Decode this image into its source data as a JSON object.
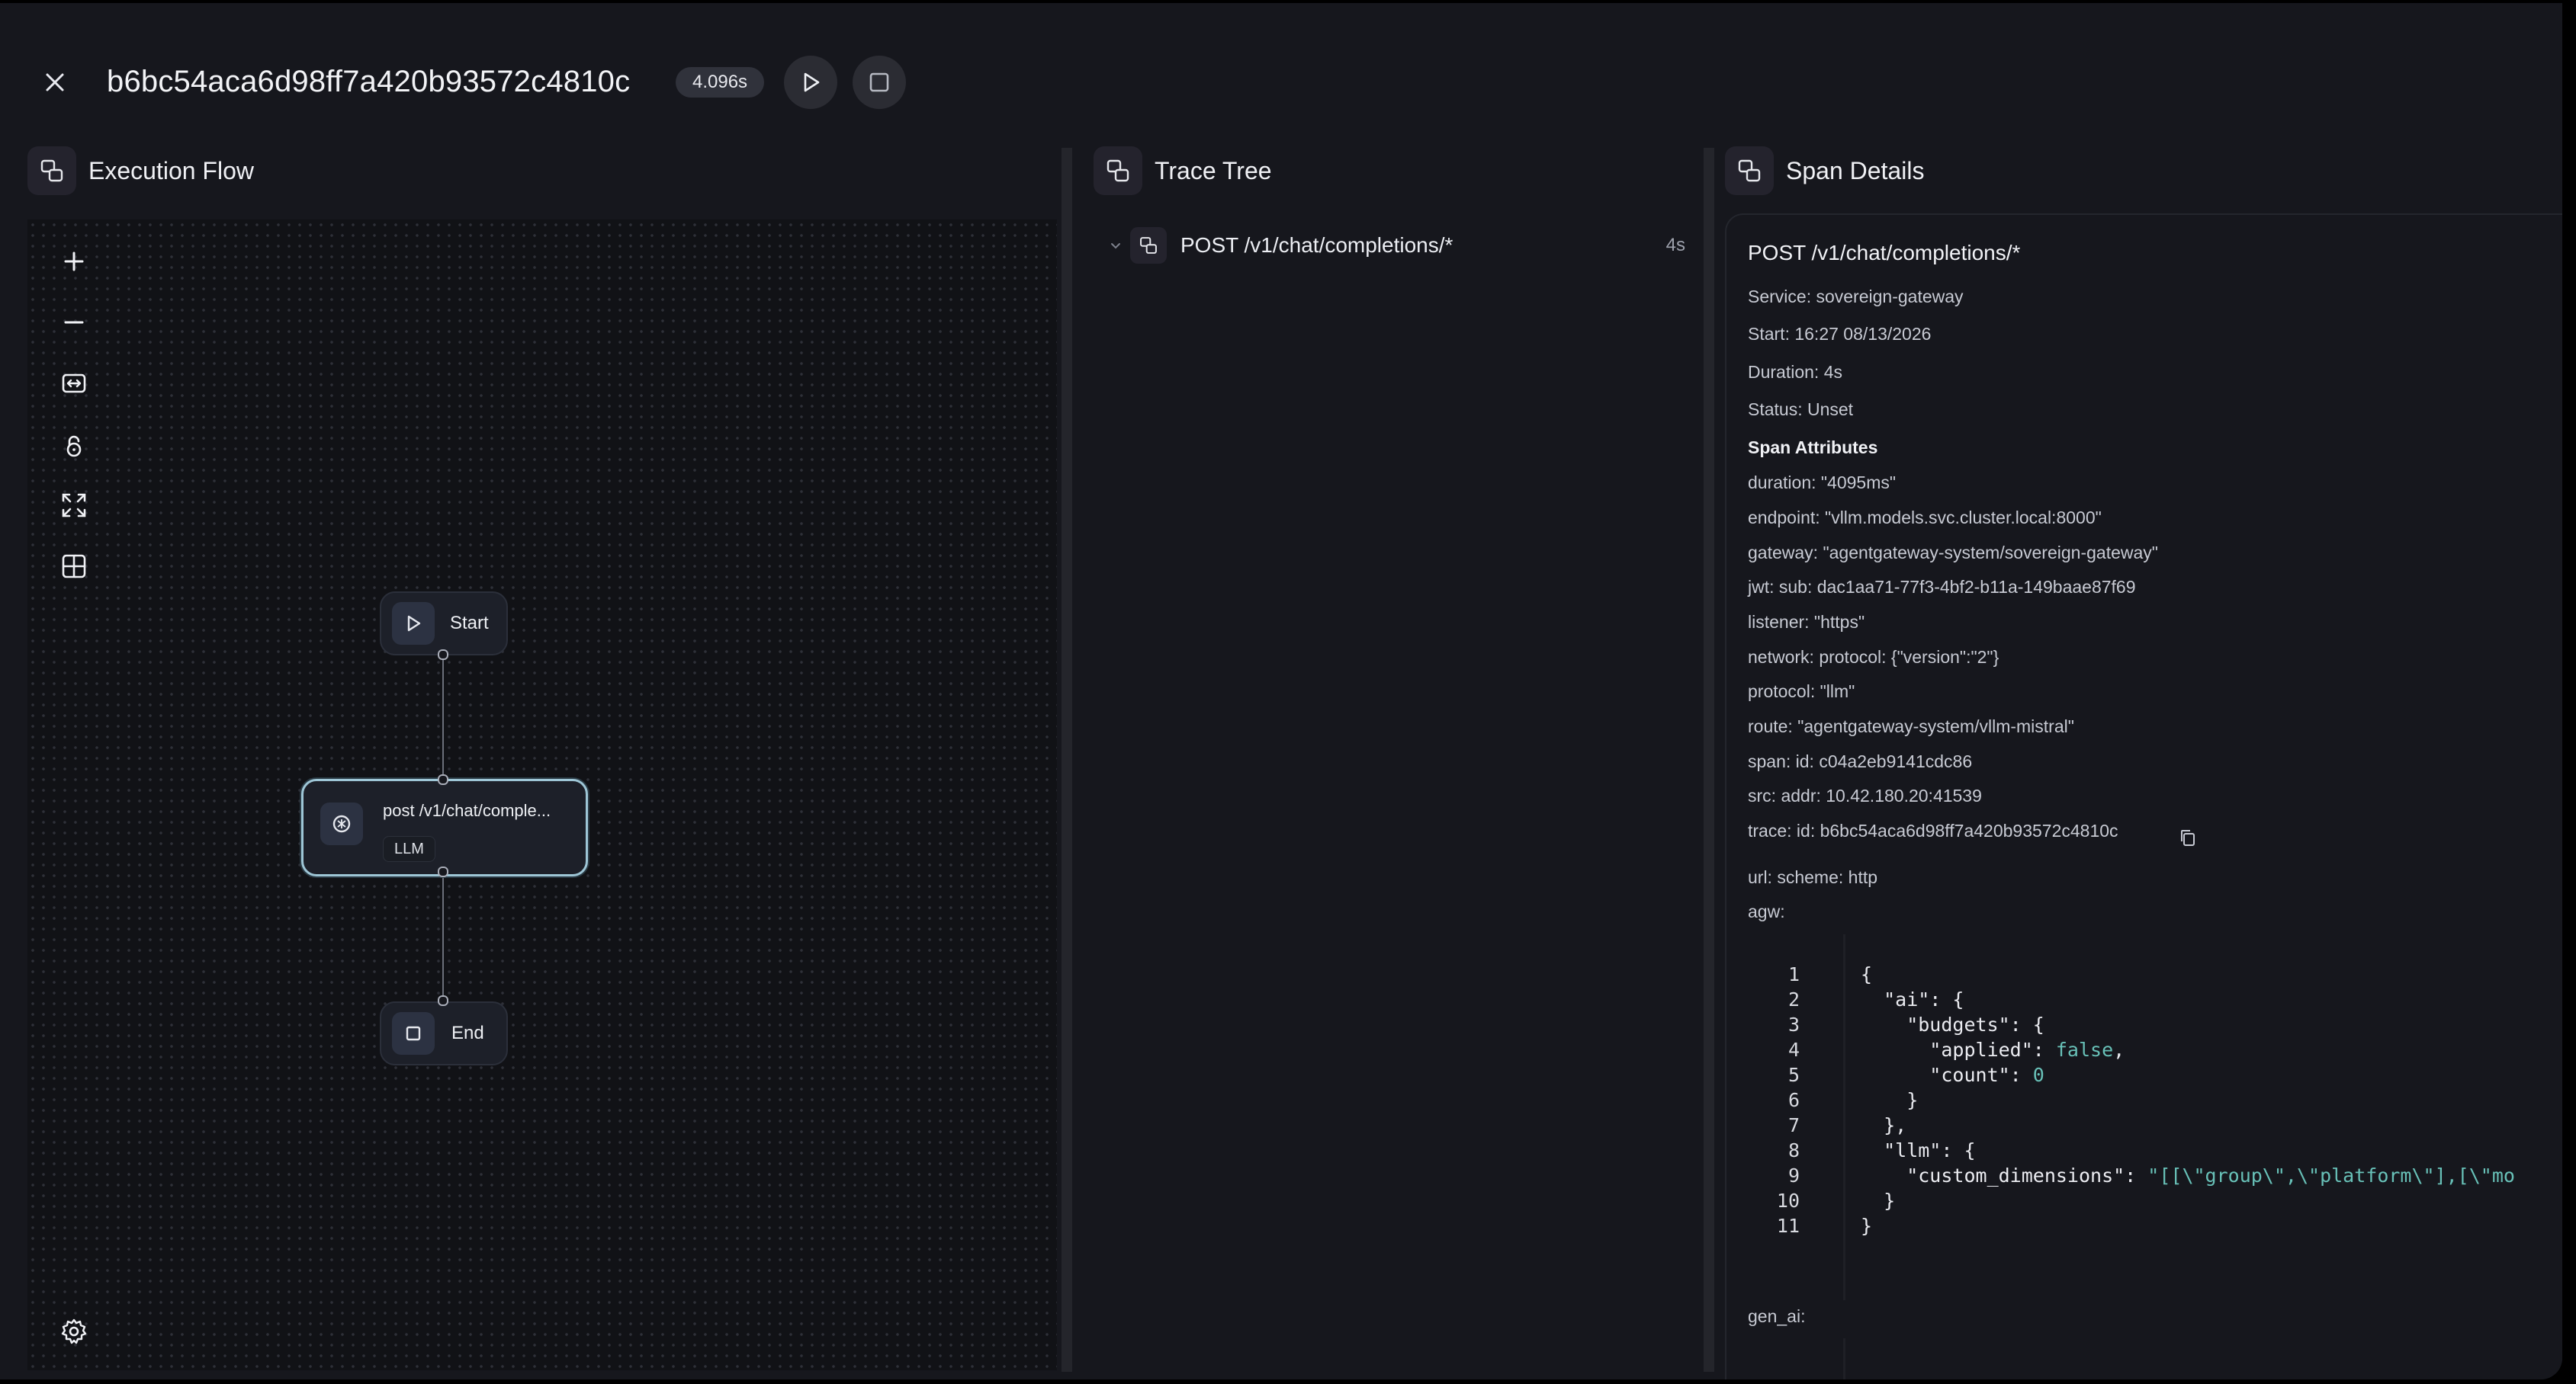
{
  "header": {
    "trace_id": "b6bc54aca6d98ff7a420b93572c4810c",
    "duration_badge": "4.096s",
    "close_icon": "close-icon",
    "play_icon": "play-icon",
    "stop_icon": "stop-icon"
  },
  "panels": {
    "execution_flow": {
      "title": "Execution Flow",
      "icon": "flow-icon"
    },
    "trace_tree": {
      "title": "Trace Tree",
      "icon": "tree-icon"
    },
    "span_details": {
      "title": "Span Details",
      "icon": "details-icon"
    }
  },
  "flow_controls": [
    "zoom-in-icon",
    "zoom-out-icon",
    "fit-view-icon",
    "lock-icon",
    "fullscreen-icon",
    "grid-icon",
    "settings-icon"
  ],
  "flow_nodes": {
    "start": {
      "label": "Start",
      "icon": "play-icon"
    },
    "llm": {
      "label": "post /v1/chat/comple...",
      "tag": "LLM",
      "icon": "llm-icon"
    },
    "end": {
      "label": "End",
      "icon": "stop-icon"
    }
  },
  "trace_tree": {
    "root": {
      "label": "POST /v1/chat/completions/*",
      "duration": "4s"
    }
  },
  "span": {
    "title": "POST /v1/chat/completions/*",
    "service": "Service: sovereign-gateway",
    "start": "Start: 16:27 08/13/2026",
    "duration": "Duration: 4s",
    "status": "Status: Unset",
    "attributes_heading": "Span Attributes",
    "attributes": [
      "duration: \"4095ms\"",
      "endpoint: \"vllm.models.svc.cluster.local:8000\"",
      "gateway: \"agentgateway-system/sovereign-gateway\"",
      "jwt: sub: dac1aa71-77f3-4bf2-b11a-149baae87f69",
      "listener: \"https\"",
      "network: protocol: {\"version\":\"2\"}",
      "protocol: \"llm\"",
      "route: \"agentgateway-system/vllm-mistral\"",
      "span: id: c04a2eb9141cdc86",
      "src: addr: 10.42.180.20:41539",
      "trace: id: b6bc54aca6d98ff7a420b93572c4810c"
    ],
    "url_scheme": "url: scheme: http",
    "agw_label": "agw:",
    "gen_ai_label": "gen_ai:",
    "code_lines": [
      {
        "n": "1",
        "text": "{"
      },
      {
        "n": "2",
        "text": "  \"ai\": {"
      },
      {
        "n": "3",
        "text": "    \"budgets\": {"
      },
      {
        "n": "4",
        "key": "      \"applied\": ",
        "val": "false",
        "tail": ","
      },
      {
        "n": "5",
        "key": "      \"count\": ",
        "val": "0",
        "tail": ""
      },
      {
        "n": "6",
        "text": "    }"
      },
      {
        "n": "7",
        "text": "  },"
      },
      {
        "n": "8",
        "text": "  \"llm\": {"
      },
      {
        "n": "9",
        "key": "    \"custom_dimensions\": ",
        "val": "\"[[\\\"group\\\",\\\"platform\\\"],[\\\"mo",
        "tail": ""
      },
      {
        "n": "10",
        "text": "  }"
      },
      {
        "n": "11",
        "text": "}"
      }
    ]
  }
}
